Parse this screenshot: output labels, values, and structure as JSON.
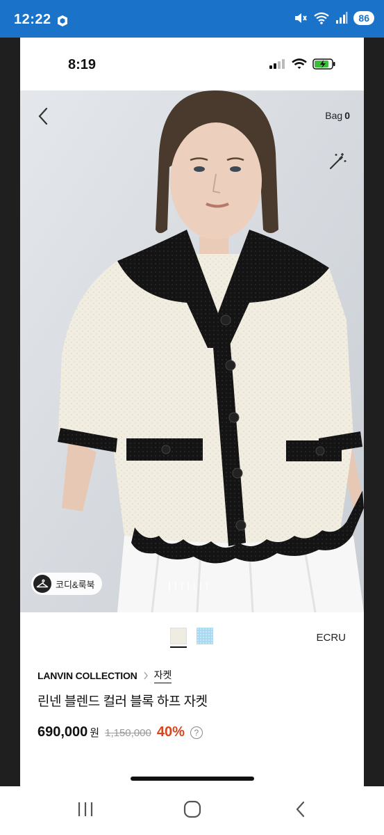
{
  "android_status": {
    "time": "12:22",
    "battery": "86",
    "app_icon": "shield-app-icon",
    "icons": [
      "mute-icon",
      "wifi-icon",
      "signal-icon"
    ]
  },
  "ios_status": {
    "time": "8:19",
    "icons": [
      "cellular-icon",
      "wifi-icon",
      "battery-charging-icon"
    ]
  },
  "header": {
    "back_icon": "chevron-left-icon",
    "bag_label": "Bag",
    "bag_count": "0",
    "magic_icon": "magic-wand-icon"
  },
  "hero": {
    "codi_label": "코디&룩북",
    "codi_icon": "hanger-icon",
    "pager_count": 7,
    "pager_active": 0
  },
  "product": {
    "swatches": [
      {
        "color": "#efece2",
        "selected": true
      },
      {
        "color": "#a8d8ef",
        "selected": false
      }
    ],
    "color_name": "ECRU",
    "brand": "LANVIN COLLECTION",
    "category": "자켓",
    "title": "린넨 블렌드 컬러 블록 하프 자켓",
    "price": "690,000",
    "currency": "원",
    "original_price": "1,150,000",
    "discount": "40%"
  },
  "android_nav": [
    "recent-apps-icon",
    "home-icon",
    "back-icon"
  ],
  "colors": {
    "android_bar": "#1a73c9",
    "discount": "#d9441e"
  }
}
